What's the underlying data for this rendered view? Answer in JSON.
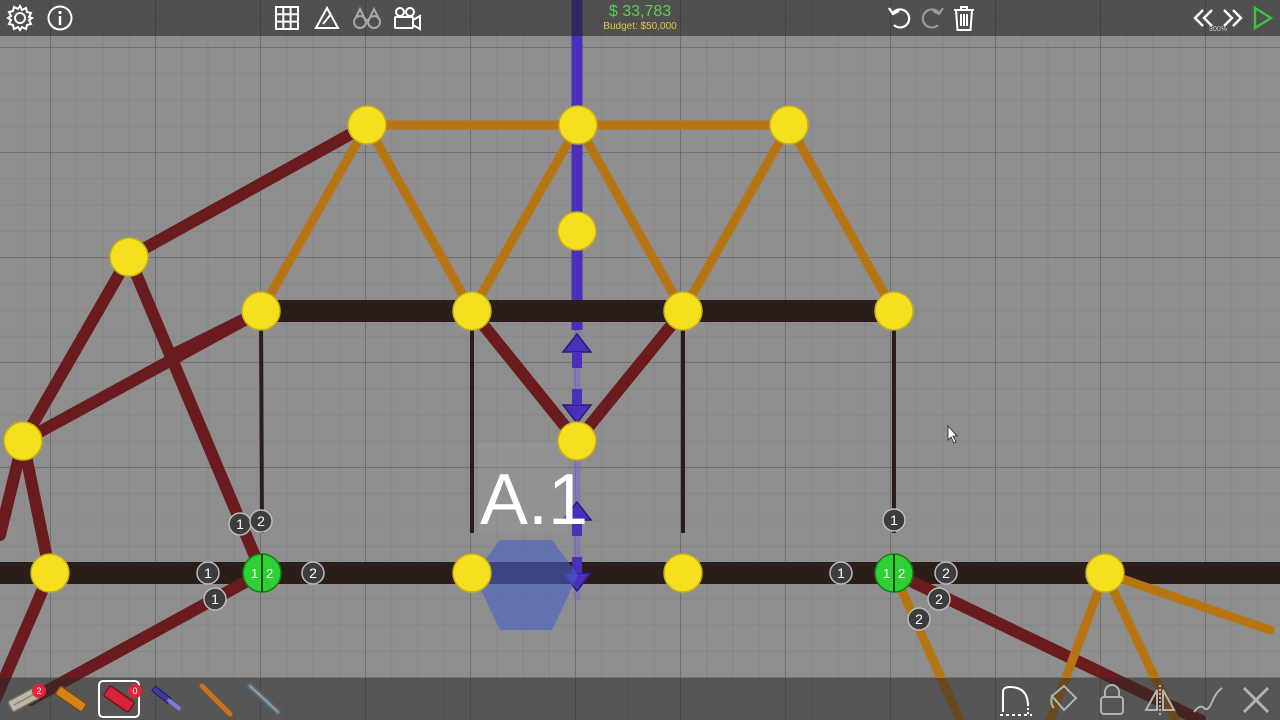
{
  "hud": {
    "cost": "$ 33,783",
    "budget": "Budget: $50,000",
    "speed": "300%"
  },
  "icons": {
    "settings": "gear-icon",
    "info": "info-icon",
    "grid": "grid-icon",
    "stress": "stress-meter-icon",
    "view": "binoculars-icon",
    "camera": "camera-icon",
    "undo": "undo-icon",
    "redo": "redo-icon",
    "delete": "trash-icon",
    "rewind": "rewind-icon",
    "fast_forward": "fast-forward-icon",
    "play": "play-icon"
  },
  "materials": [
    {
      "name": "road",
      "count": "2"
    },
    {
      "name": "wood"
    },
    {
      "name": "reinforced-road",
      "count": "0"
    },
    {
      "name": "hydraulics"
    },
    {
      "name": "rope"
    },
    {
      "name": "steel"
    }
  ],
  "bottom_tools": [
    "split-icon",
    "paint-icon",
    "lock-icon",
    "mirror-icon",
    "spring-icon",
    "cancel-icon"
  ],
  "vehicle_label": "A.1",
  "joint_labels": {
    "left_split": [
      "1",
      "2"
    ],
    "right_split": [
      "1",
      "2"
    ],
    "left_tags": [
      "1",
      "2",
      "1",
      "2",
      "1"
    ],
    "right_tags": [
      "1",
      "1",
      "2",
      "2",
      "2"
    ]
  },
  "colors": {
    "steel": "#6a1b1e",
    "wood": "#b77413",
    "road": "#2a1d1a",
    "joint": "#f5e020",
    "split_joint": "#2fd033",
    "hydraulic": "#4b2fb8",
    "cost_text": "#58d04a",
    "budget_text": "#e6c34a"
  }
}
